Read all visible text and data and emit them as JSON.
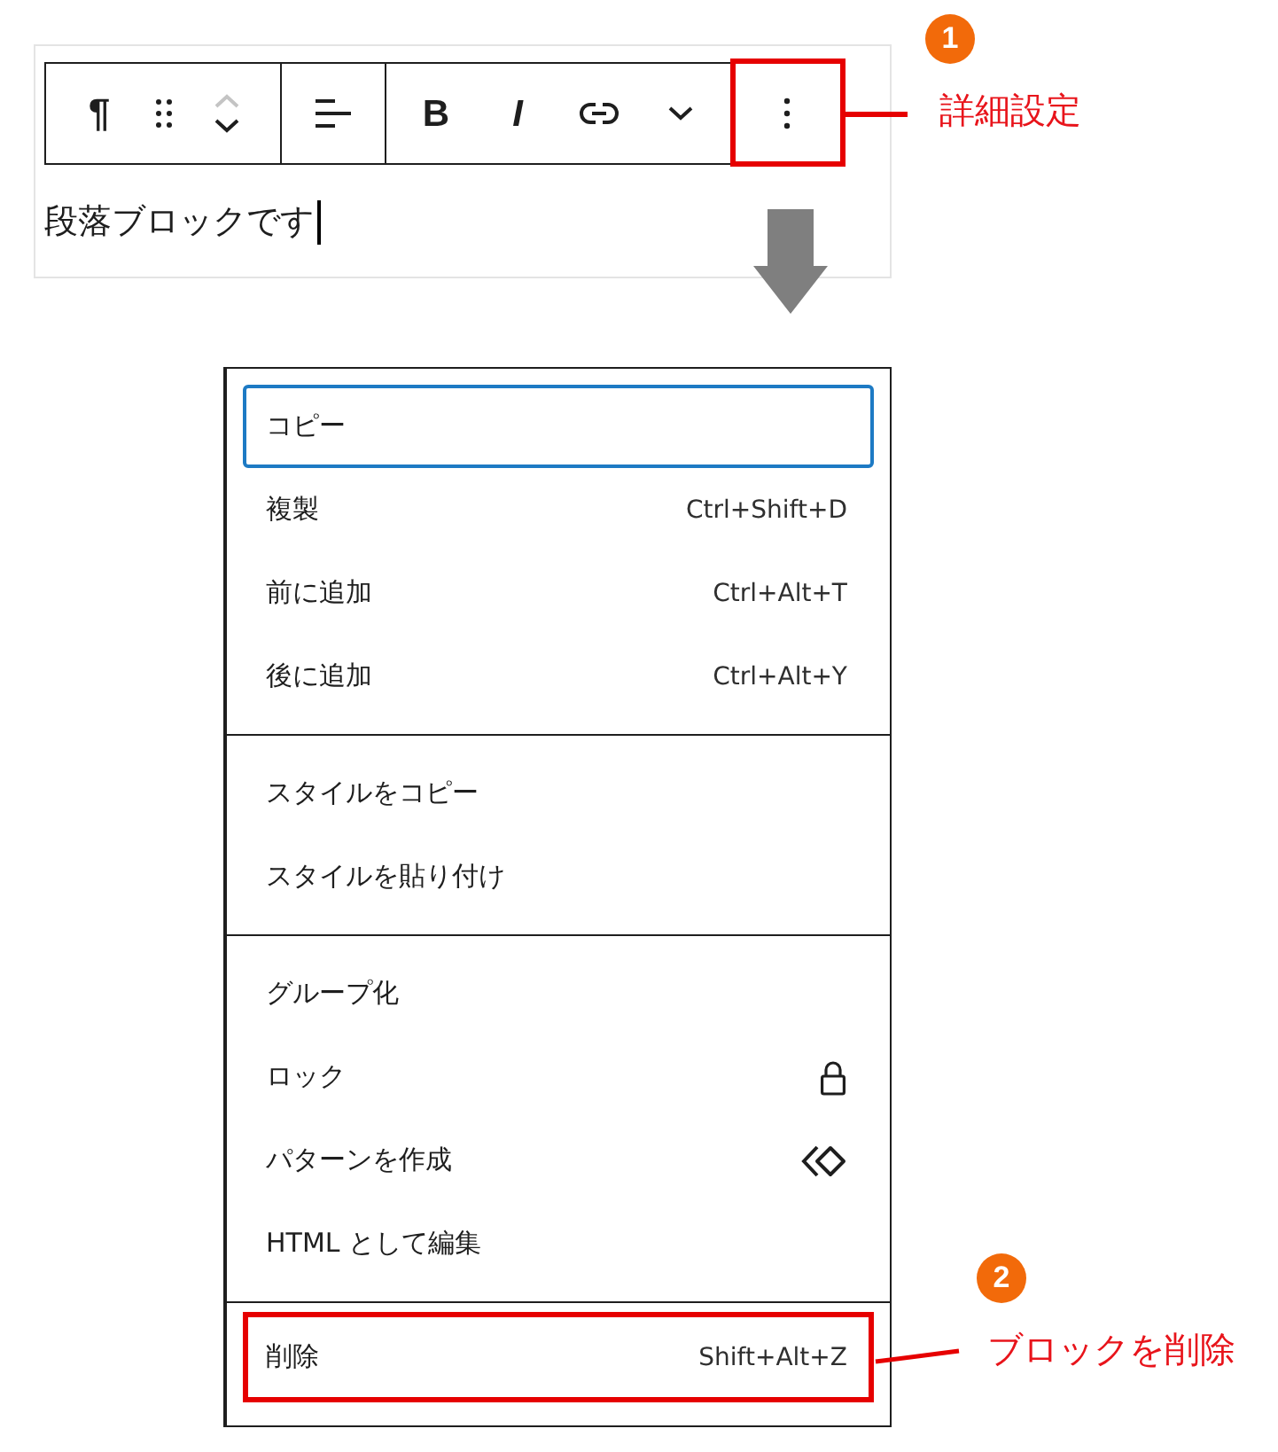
{
  "editor": {
    "toolbar": {
      "groups": [
        {
          "buttons": [
            {
              "kind": "paragraph",
              "label": "¶",
              "highlighted": false
            },
            {
              "kind": "drag",
              "highlighted": false
            },
            {
              "kind": "mover",
              "up_disabled": true,
              "down_disabled": false,
              "highlighted": false
            }
          ]
        },
        {
          "buttons": [
            {
              "kind": "align",
              "highlighted": false
            }
          ]
        },
        {
          "buttons": [
            {
              "kind": "bold",
              "label": "B",
              "highlighted": false
            },
            {
              "kind": "italic",
              "label": "I",
              "highlighted": false
            },
            {
              "kind": "link",
              "highlighted": false
            },
            {
              "kind": "more",
              "highlighted": false
            }
          ]
        },
        {
          "buttons": [
            {
              "kind": "options",
              "highlighted": true
            }
          ]
        }
      ]
    },
    "paragraph": {
      "text": "段落ブロックです",
      "caret": true
    }
  },
  "menu": {
    "sections": [
      {
        "items": [
          {
            "kind": "plain",
            "label": "コピー",
            "focused": true,
            "highlighted": false
          },
          {
            "kind": "shortcut",
            "label": "複製",
            "shortcut": "Ctrl+Shift+D",
            "focused": false,
            "highlighted": false
          },
          {
            "kind": "shortcut",
            "label": "前に追加",
            "shortcut": "Ctrl+Alt+T",
            "focused": false,
            "highlighted": false
          },
          {
            "kind": "shortcut",
            "label": "後に追加",
            "shortcut": "Ctrl+Alt+Y",
            "focused": false,
            "highlighted": false
          }
        ]
      },
      {
        "items": [
          {
            "kind": "plain",
            "label": "スタイルをコピー",
            "focused": false,
            "highlighted": false
          },
          {
            "kind": "plain",
            "label": "スタイルを貼り付け",
            "focused": false,
            "highlighted": false
          }
        ]
      },
      {
        "items": [
          {
            "kind": "plain",
            "label": "グループ化",
            "focused": false,
            "highlighted": false
          },
          {
            "kind": "lock",
            "label": "ロック",
            "focused": false,
            "highlighted": false
          },
          {
            "kind": "pattern",
            "label": "パターンを作成",
            "focused": false,
            "highlighted": false
          },
          {
            "kind": "plain",
            "label": "HTML として編集",
            "focused": false,
            "highlighted": false
          }
        ]
      },
      {
        "items": [
          {
            "kind": "shortcut",
            "label": "削除",
            "shortcut": "Shift+Alt+Z",
            "focused": false,
            "highlighted": true
          }
        ]
      }
    ]
  },
  "callouts": [
    {
      "number": "1",
      "label": "詳細設定"
    },
    {
      "number": "2",
      "label": "ブロックを削除"
    }
  ]
}
